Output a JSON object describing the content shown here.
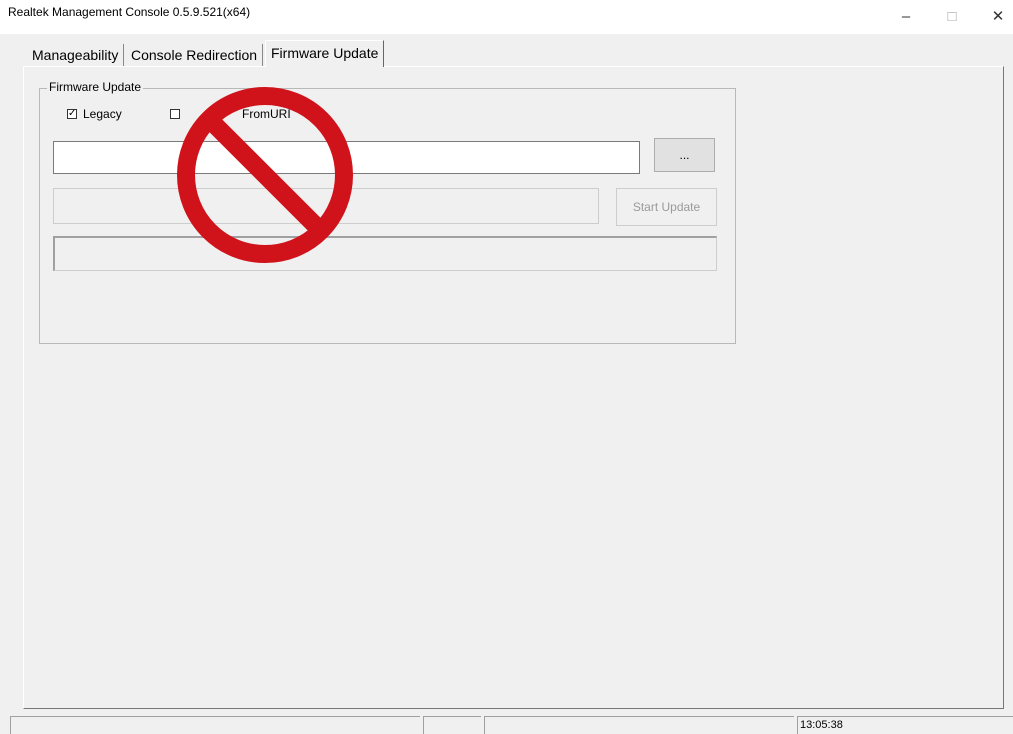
{
  "window": {
    "title": "Realtek Management Console 0.5.9.521(x64)",
    "controls": {
      "minimize": "–",
      "maximize": "□",
      "close": "✕"
    }
  },
  "tabs": [
    {
      "label": "Manageability",
      "active": false
    },
    {
      "label": "Console Redirection",
      "active": false
    },
    {
      "label": "Firmware Update",
      "active": true
    }
  ],
  "firmware_group": {
    "legend": "Firmware Update",
    "legacy": {
      "label": "Legacy",
      "checked": true
    },
    "from_uri": {
      "label": "FromURI",
      "checked": false
    },
    "file_path_value": "",
    "browse_label": "...",
    "progress_value": "",
    "start_button": {
      "label": "Start Update",
      "enabled": false
    },
    "status_value": ""
  },
  "overlay": {
    "icon": "prohibited-icon",
    "color": "#d0121b"
  },
  "statusbar": {
    "time": "13:05:38"
  }
}
